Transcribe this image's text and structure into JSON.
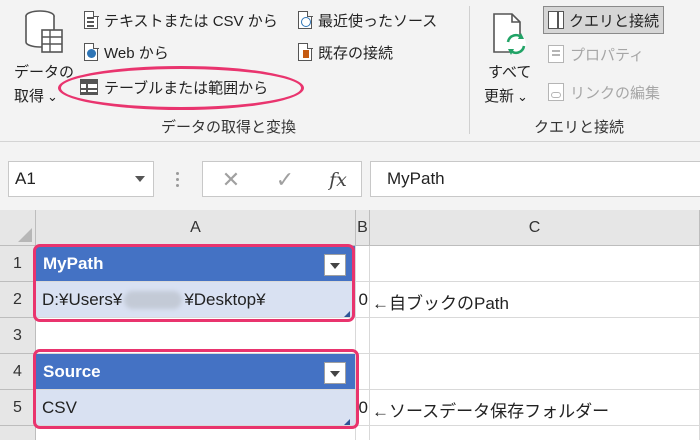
{
  "ribbon": {
    "get_data": {
      "line1": "データの",
      "line2": "取得",
      "arrow": "⌄"
    },
    "from_text_csv": "テキストまたは CSV から",
    "from_web": "Web から",
    "from_table_range": "テーブルまたは範囲から",
    "recent_sources": "最近使ったソース",
    "existing_connections": "既存の接続",
    "group_get_transform": "データの取得と変換",
    "refresh_all": {
      "line1": "すべて",
      "line2": "更新",
      "arrow": "⌄"
    },
    "queries_connections": "クエリと接続",
    "properties": "プロパティ",
    "edit_links": "リンクの編集",
    "group_queries": "クエリと接続"
  },
  "formula_bar": {
    "name_box": "A1",
    "cancel_glyph": "✕",
    "enter_glyph": "✓",
    "fx": "fx",
    "content": "MyPath"
  },
  "grid": {
    "columns": [
      "A",
      "B",
      "C"
    ],
    "rows": [
      "1",
      "2",
      "3",
      "4",
      "5"
    ],
    "table1": {
      "header": "MyPath",
      "value_prefix": "D:¥Users¥",
      "value_suffix": "¥Desktop¥"
    },
    "table2": {
      "header": "Source",
      "value": "CSV"
    },
    "b2": "0",
    "b5": "0",
    "note_row2": "←自ブックのPath",
    "note_row5": "←ソースデータ保存フォルダー"
  },
  "colors": {
    "table_header": "#4472c4",
    "table_row": "#d9e1f2",
    "highlight": "#e9346e",
    "refresh_green": "#21a366"
  }
}
